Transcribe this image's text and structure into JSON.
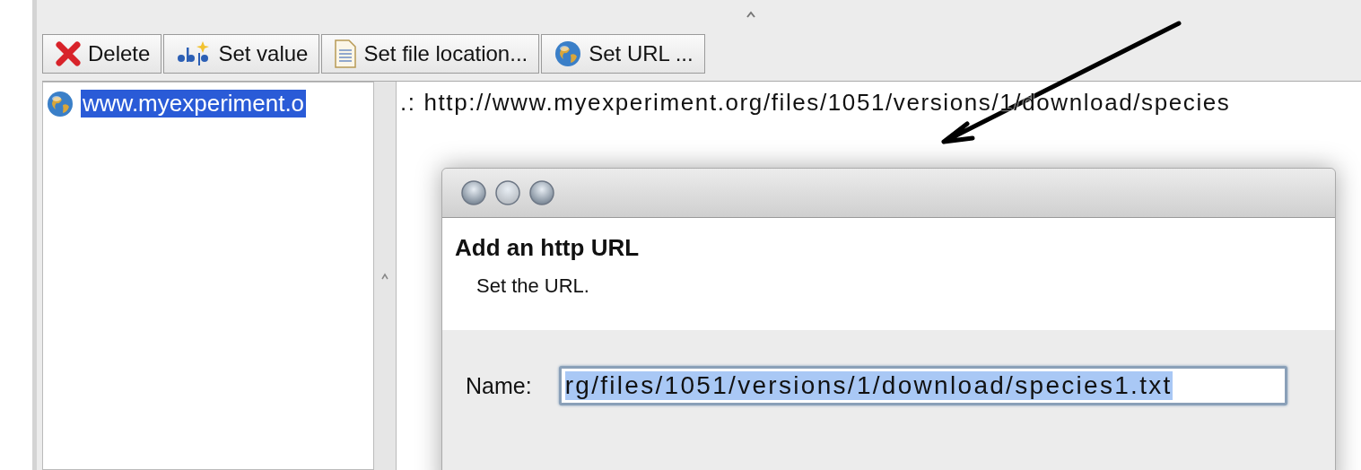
{
  "toolbar": {
    "buttons": [
      {
        "label": "Delete",
        "kind": "delete"
      },
      {
        "label": "Set value",
        "kind": "value"
      },
      {
        "label": "Set file location...",
        "kind": "file"
      },
      {
        "label": "Set URL ...",
        "kind": "url"
      }
    ]
  },
  "tree": {
    "items": [
      {
        "label": "www.myexperiment.o",
        "selected": true
      }
    ]
  },
  "detail": {
    "text": ".: http://www.myexperiment.org/files/1051/versions/1/download/species"
  },
  "dialog": {
    "heading": "Add an http URL",
    "subheading": "Set the URL.",
    "field": {
      "label": "Name:",
      "value": "rg/files/1051/versions/1/download/species1.txt",
      "text_selected": true
    }
  }
}
